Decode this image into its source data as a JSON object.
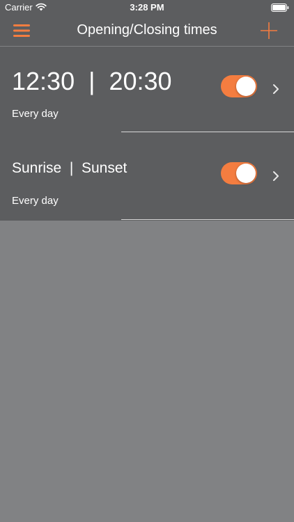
{
  "status_bar": {
    "carrier": "Carrier",
    "time": "3:28 PM"
  },
  "nav": {
    "title": "Opening/Closing times",
    "menu_icon": "hamburger-menu-icon",
    "add_icon": "plus-icon"
  },
  "schedules": [
    {
      "title": "12:30  |  20:30",
      "repeat": "Every day",
      "enabled": true
    },
    {
      "title": "Sunrise  |  Sunset",
      "repeat": "Every day",
      "enabled": true
    }
  ],
  "colors": {
    "accent": "#f47d40",
    "list_background": "#5c5d5f",
    "screen_background": "#818284"
  }
}
